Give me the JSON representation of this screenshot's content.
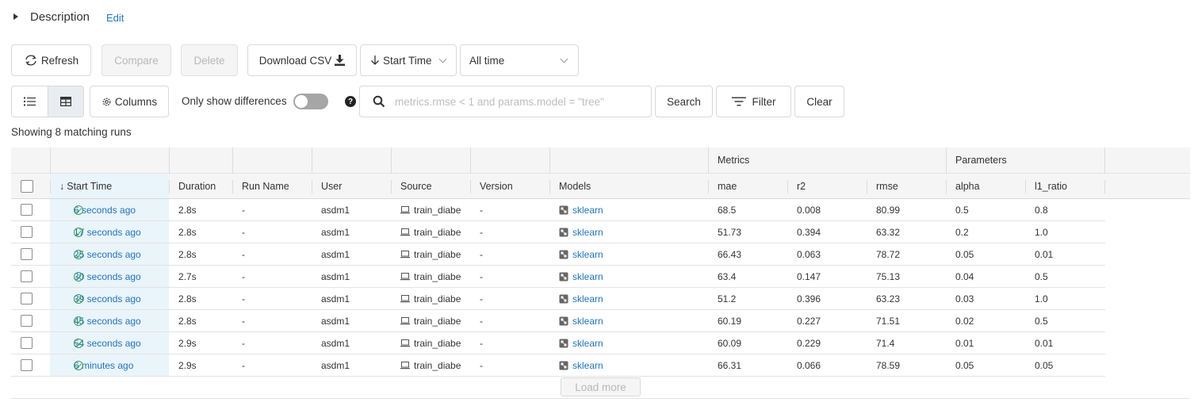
{
  "description": {
    "title": "Description",
    "edit_label": "Edit"
  },
  "toolbar": {
    "refresh_label": "Refresh",
    "compare_label": "Compare",
    "delete_label": "Delete",
    "download_label": "Download CSV",
    "sort_label": "Start Time",
    "time_range_label": "All time"
  },
  "filters": {
    "columns_label": "Columns",
    "only_diff_label": "Only show differences",
    "only_diff_enabled": false,
    "help_glyph": "?",
    "search_placeholder": "metrics.rmse < 1 and params.model = \"tree\"",
    "search_value": "",
    "search_label": "Search",
    "filter_label": "Filter",
    "clear_label": "Clear"
  },
  "status": {
    "showing": "Showing 8 matching runs"
  },
  "table": {
    "groups": {
      "metrics": "Metrics",
      "parameters": "Parameters"
    },
    "columns": {
      "start_time": "Start Time",
      "duration": "Duration",
      "run_name": "Run Name",
      "user": "User",
      "source": "Source",
      "version": "Version",
      "models": "Models",
      "mae": "mae",
      "r2": "r2",
      "rmse": "rmse",
      "alpha": "alpha",
      "l1_ratio": "l1_ratio"
    },
    "rows": [
      {
        "start_time": "6 seconds ago",
        "duration": "2.8s",
        "run_name": "-",
        "user": "asdm1",
        "source": "train_diabe",
        "version": "-",
        "model": "sklearn",
        "mae": "68.5",
        "r2": "0.008",
        "rmse": "80.99",
        "alpha": "0.5",
        "l1_ratio": "0.8"
      },
      {
        "start_time": "17 seconds ago",
        "duration": "2.8s",
        "run_name": "-",
        "user": "asdm1",
        "source": "train_diabe",
        "version": "-",
        "model": "sklearn",
        "mae": "51.73",
        "r2": "0.394",
        "rmse": "63.32",
        "alpha": "0.2",
        "l1_ratio": "1.0"
      },
      {
        "start_time": "25 seconds ago",
        "duration": "2.8s",
        "run_name": "-",
        "user": "asdm1",
        "source": "train_diabe",
        "version": "-",
        "model": "sklearn",
        "mae": "66.43",
        "r2": "0.063",
        "rmse": "78.72",
        "alpha": "0.05",
        "l1_ratio": "0.01"
      },
      {
        "start_time": "30 seconds ago",
        "duration": "2.7s",
        "run_name": "-",
        "user": "asdm1",
        "source": "train_diabe",
        "version": "-",
        "model": "sklearn",
        "mae": "63.4",
        "r2": "0.147",
        "rmse": "75.13",
        "alpha": "0.04",
        "l1_ratio": "0.5"
      },
      {
        "start_time": "39 seconds ago",
        "duration": "2.8s",
        "run_name": "-",
        "user": "asdm1",
        "source": "train_diabe",
        "version": "-",
        "model": "sklearn",
        "mae": "51.2",
        "r2": "0.396",
        "rmse": "63.23",
        "alpha": "0.03",
        "l1_ratio": "1.0"
      },
      {
        "start_time": "45 seconds ago",
        "duration": "2.8s",
        "run_name": "-",
        "user": "asdm1",
        "source": "train_diabe",
        "version": "-",
        "model": "sklearn",
        "mae": "60.19",
        "r2": "0.227",
        "rmse": "71.51",
        "alpha": "0.02",
        "l1_ratio": "0.5"
      },
      {
        "start_time": "54 seconds ago",
        "duration": "2.9s",
        "run_name": "-",
        "user": "asdm1",
        "source": "train_diabe",
        "version": "-",
        "model": "sklearn",
        "mae": "60.09",
        "r2": "0.229",
        "rmse": "71.4",
        "alpha": "0.01",
        "l1_ratio": "0.01"
      },
      {
        "start_time": "6 minutes ago",
        "duration": "2.9s",
        "run_name": "-",
        "user": "asdm1",
        "source": "train_diabe",
        "version": "-",
        "model": "sklearn",
        "mae": "66.31",
        "r2": "0.066",
        "rmse": "78.59",
        "alpha": "0.05",
        "l1_ratio": "0.05"
      }
    ],
    "load_more_label": "Load more"
  },
  "colors": {
    "link": "#2374bb",
    "time_column_bg": "#eaf4fb",
    "success": "#3b9c5d"
  }
}
